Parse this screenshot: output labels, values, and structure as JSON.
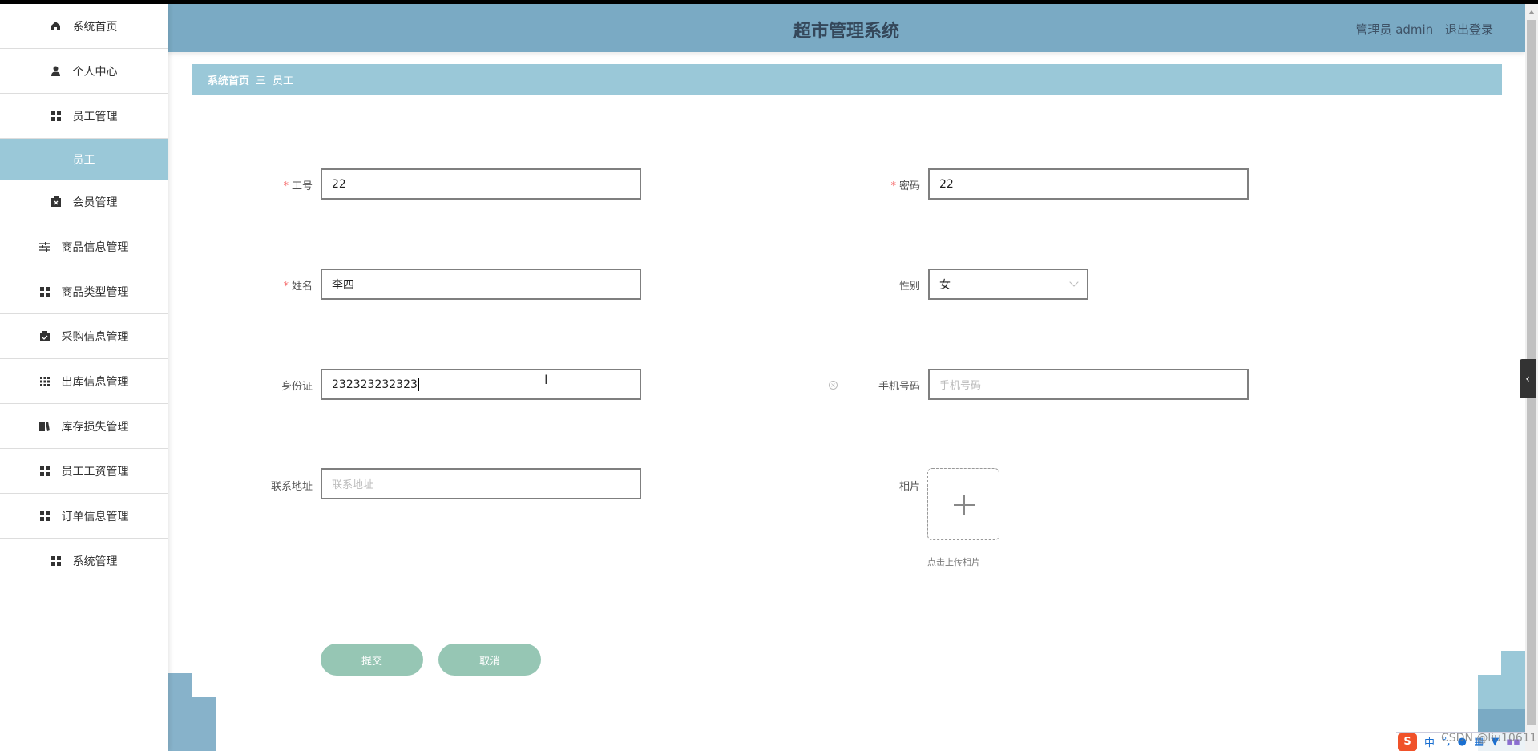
{
  "sidebar": {
    "items": [
      {
        "label": "系统首页",
        "icon": "home-icon"
      },
      {
        "label": "个人中心",
        "icon": "user-icon"
      },
      {
        "label": "员工管理",
        "icon": "grid-icon"
      },
      {
        "label": "员工",
        "active": true
      },
      {
        "label": "会员管理",
        "icon": "clipboard-x-icon"
      },
      {
        "label": "商品信息管理",
        "icon": "sliders-icon"
      },
      {
        "label": "商品类型管理",
        "icon": "grid-icon"
      },
      {
        "label": "采购信息管理",
        "icon": "clipboard-check-icon"
      },
      {
        "label": "出库信息管理",
        "icon": "grid-3x3-icon"
      },
      {
        "label": "库存损失管理",
        "icon": "book-icon"
      },
      {
        "label": "员工工资管理",
        "icon": "grid-icon"
      },
      {
        "label": "订单信息管理",
        "icon": "grid-icon"
      },
      {
        "label": "系统管理",
        "icon": "grid-icon"
      }
    ]
  },
  "header": {
    "title": "超市管理系统",
    "user": "管理员 admin",
    "logout": "退出登录"
  },
  "breadcrumb": {
    "home": "系统首页",
    "separator": "三",
    "current": "员工"
  },
  "form": {
    "emp_no": {
      "label": "工号",
      "value": "22",
      "required": true
    },
    "password": {
      "label": "密码",
      "value": "22",
      "required": true
    },
    "name": {
      "label": "姓名",
      "value": "李四",
      "required": true
    },
    "gender": {
      "label": "性别",
      "value": "女"
    },
    "id_card": {
      "label": "身份证",
      "value": "232323232323"
    },
    "phone": {
      "label": "手机号码",
      "placeholder": "手机号码"
    },
    "address": {
      "label": "联系地址",
      "placeholder": "联系地址"
    },
    "photo": {
      "label": "相片",
      "tip": "点击上传相片"
    },
    "submit": "提交",
    "cancel": "取消"
  },
  "ime": {
    "lang": "中"
  },
  "watermark": "CSDN @liu10611",
  "colors": {
    "header": "#7aaac4",
    "accent": "#9ac8d8",
    "button": "#96c6b4",
    "required": "#f56c6c"
  }
}
